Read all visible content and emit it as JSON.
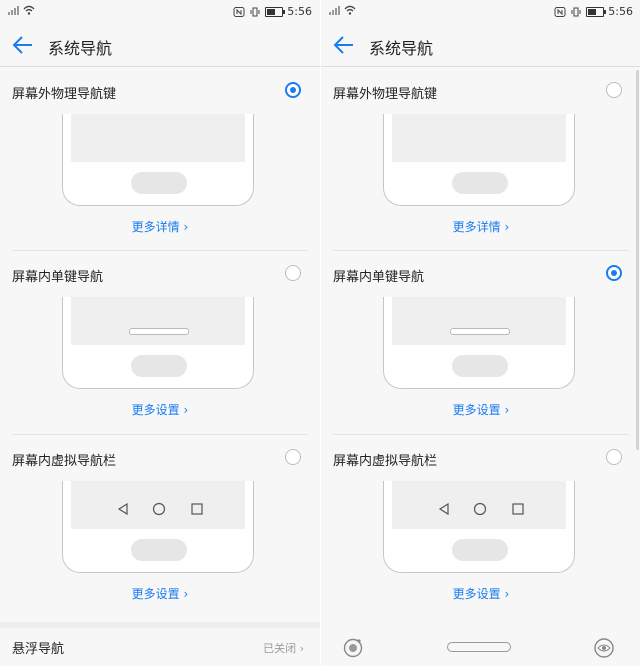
{
  "status_bar": {
    "time": "5:56"
  },
  "left": {
    "title": "系统导航",
    "options": [
      {
        "label": "屏幕外物理导航键",
        "selected": true,
        "more": "更多详情"
      },
      {
        "label": "屏幕内单键导航",
        "selected": false,
        "more": "更多设置"
      },
      {
        "label": "屏幕内虚拟导航栏",
        "selected": false,
        "more": "更多设置"
      }
    ],
    "floating": {
      "label": "悬浮导航",
      "status": "已关闭"
    }
  },
  "right": {
    "title": "系统导航",
    "options": [
      {
        "label": "屏幕外物理导航键",
        "selected": false,
        "more": "更多详情"
      },
      {
        "label": "屏幕内单键导航",
        "selected": true,
        "more": "更多设置"
      },
      {
        "label": "屏幕内虚拟导航栏",
        "selected": false,
        "more": "更多设置"
      }
    ]
  },
  "colors": {
    "accent": "#1a7cf2"
  }
}
